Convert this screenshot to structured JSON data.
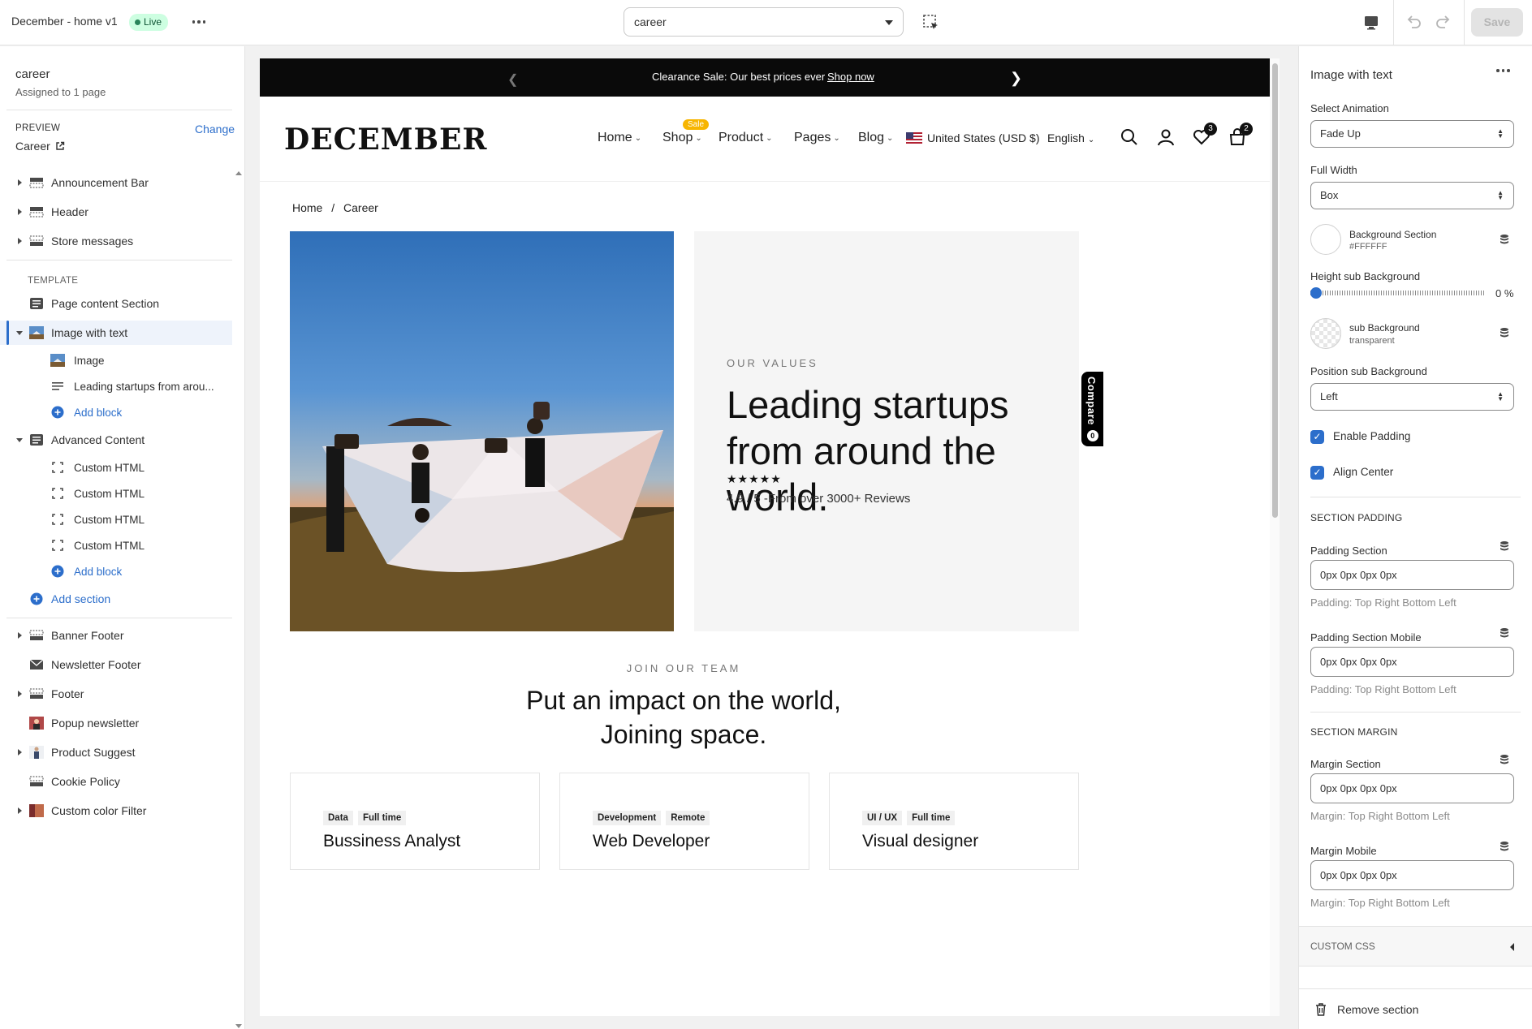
{
  "topbar": {
    "title": "December - home v1",
    "status": "Live",
    "page_select": "career",
    "save_label": "Save"
  },
  "left": {
    "page_name": "career",
    "assigned": "Assigned to 1 page",
    "preview_label": "PREVIEW",
    "change_label": "Change",
    "preview_value": "Career",
    "template_label": "TEMPLATE",
    "header_sections": [
      "Announcement Bar",
      "Header",
      "Store messages"
    ],
    "template_sections": {
      "page_content": "Page content Section",
      "image_with_text": "Image with text",
      "iwt_blocks": [
        "Image",
        "Leading startups from arou..."
      ],
      "add_block": "Add block",
      "advanced_content": "Advanced Content",
      "adv_blocks": [
        "Custom HTML",
        "Custom HTML",
        "Custom HTML",
        "Custom HTML"
      ],
      "add_section": "Add section"
    },
    "footer_sections": [
      "Banner Footer",
      "Newsletter Footer",
      "Footer",
      "Popup newsletter",
      "Product Suggest",
      "Cookie Policy",
      "Custom color Filter"
    ]
  },
  "preview": {
    "announcement": {
      "text": "Clearance Sale: Our best prices ever",
      "link": "Shop now"
    },
    "logo": "DECEMBER",
    "nav": [
      "Home",
      "Shop",
      "Product",
      "Pages",
      "Blog"
    ],
    "sale_badge": "Sale",
    "currency": "United States (USD $)",
    "language": "English",
    "wishlist_count": "3",
    "cart_count": "2",
    "breadcrumb": {
      "home": "Home",
      "sep": "/",
      "current": "Career"
    },
    "hero": {
      "overline": "OUR VALUES",
      "heading": "Leading startups from around the world.",
      "stars": "★★★★★",
      "reviews": "4.9 / 5 -From over 3000+ Reviews"
    },
    "compare_label": "Compare",
    "compare_count": "0",
    "team": {
      "overline": "JOIN OUR TEAM",
      "heading_line1": "Put an impact on the world,",
      "heading_line2": "Joining space."
    },
    "jobs": [
      {
        "tags": [
          "Data",
          "Full time"
        ],
        "title": "Bussiness Analyst"
      },
      {
        "tags": [
          "Development",
          "Remote"
        ],
        "title": "Web Developer"
      },
      {
        "tags": [
          "UI / UX",
          "Full time"
        ],
        "title": "Visual designer"
      }
    ]
  },
  "right": {
    "title": "Image with text",
    "select_animation_label": "Select Animation",
    "select_animation_value": "Fade Up",
    "full_width_label": "Full Width",
    "full_width_value": "Box",
    "bg_section_label": "Background Section",
    "bg_section_value": "#FFFFFF",
    "height_sub_bg_label": "Height sub Background",
    "height_sub_bg_value": "0 %",
    "height_sub_bg_level": 0,
    "sub_bg_label": "sub Background",
    "sub_bg_value": "transparent",
    "position_sub_bg_label": "Position sub Background",
    "position_sub_bg_value": "Left",
    "enable_padding_label": "Enable Padding",
    "enable_padding_checked": true,
    "align_center_label": "Align Center",
    "align_center_checked": true,
    "section_padding_head": "SECTION PADDING",
    "padding_section_label": "Padding Section",
    "padding_section_value": "0px 0px 0px 0px",
    "padding_help": "Padding: Top Right Bottom Left",
    "padding_mobile_label": "Padding Section Mobile",
    "padding_mobile_value": "0px 0px 0px 0px",
    "padding_mobile_help": "Padding: Top Right Bottom Left",
    "section_margin_head": "SECTION MARGIN",
    "margin_section_label": "Margin Section",
    "margin_section_value": "0px 0px 0px 0px",
    "margin_help": "Margin: Top Right Bottom Left",
    "margin_mobile_label": "Margin Mobile",
    "margin_mobile_value": "0px 0px 0px 0px",
    "margin_mobile_help": "Margin: Top Right Bottom Left",
    "custom_css_label": "CUSTOM CSS",
    "remove_label": "Remove section"
  },
  "colors": {
    "accent": "#2c6ecb",
    "live_bg": "#cdfee1",
    "sale": "#f7b500"
  }
}
